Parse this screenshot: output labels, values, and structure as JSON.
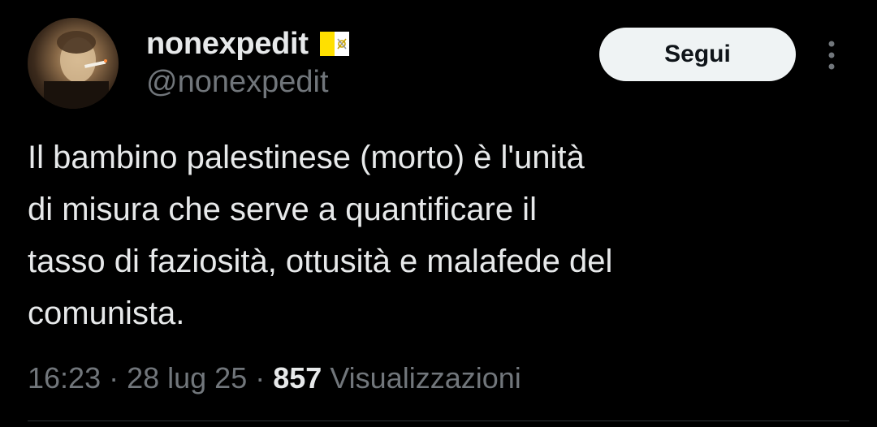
{
  "author": {
    "display_name": "nonexpedit",
    "handle": "@nonexpedit",
    "badge_icon": "vatican-flag-icon"
  },
  "follow_button": {
    "label": "Segui"
  },
  "more_menu": {
    "icon": "more-vertical-icon"
  },
  "tweet": {
    "text_lines": [
      "Il bambino palestinese (morto) è l'unità",
      "di misura che serve a quantificare il",
      "tasso di faziosità, ottusità e malafede del",
      "comunista."
    ]
  },
  "meta": {
    "time": "16:23",
    "separator": "·",
    "date": "28 lug 25",
    "views_count": "857",
    "views_label": "Visualizzazioni"
  },
  "colors": {
    "background": "#000000",
    "primary_text": "#e7e9ea",
    "secondary_text": "#71767b",
    "button_bg": "#eff3f4",
    "button_text": "#0f1419",
    "flag_yellow": "#ffe000",
    "flag_white": "#ffffff"
  }
}
